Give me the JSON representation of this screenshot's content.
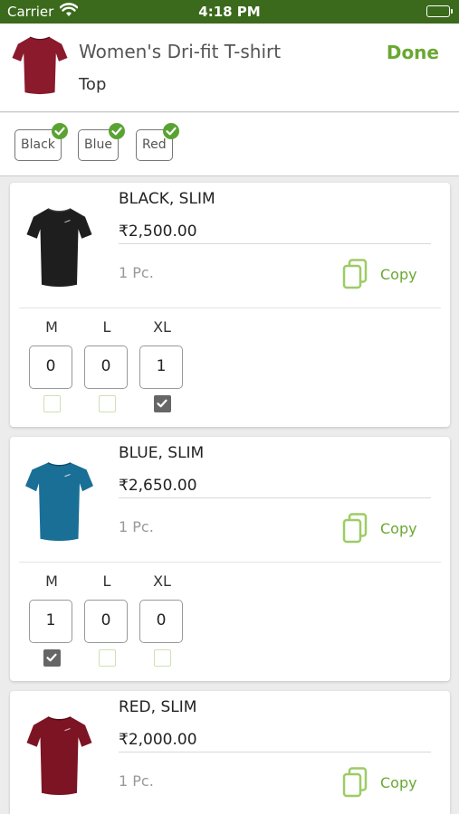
{
  "status_bar": {
    "carrier": "Carrier",
    "time": "4:18 PM"
  },
  "product": {
    "title": "Women's Dri-fit T-shirt",
    "category": "Top",
    "done_label": "Done"
  },
  "colors": [
    "Black",
    "Blue",
    "Red"
  ],
  "accent_color": "#6aa832",
  "variants": [
    {
      "name": "BLACK, SLIM",
      "price": "₹2,500.00",
      "pcs": "1 Pc.",
      "copy_label": "Copy",
      "shirt_color": "#1e1e1e",
      "sizes": [
        {
          "label": "M",
          "qty": "0",
          "checked": false
        },
        {
          "label": "L",
          "qty": "0",
          "checked": false
        },
        {
          "label": "XL",
          "qty": "1",
          "checked": true
        }
      ]
    },
    {
      "name": "BLUE, SLIM",
      "price": "₹2,650.00",
      "pcs": "1 Pc.",
      "copy_label": "Copy",
      "shirt_color": "#1a6f96",
      "sizes": [
        {
          "label": "M",
          "qty": "1",
          "checked": true
        },
        {
          "label": "L",
          "qty": "0",
          "checked": false
        },
        {
          "label": "XL",
          "qty": "0",
          "checked": false
        }
      ]
    },
    {
      "name": "RED, SLIM",
      "price": "₹2,000.00",
      "pcs": "1 Pc.",
      "copy_label": "Copy",
      "shirt_color": "#7d1424"
    }
  ]
}
